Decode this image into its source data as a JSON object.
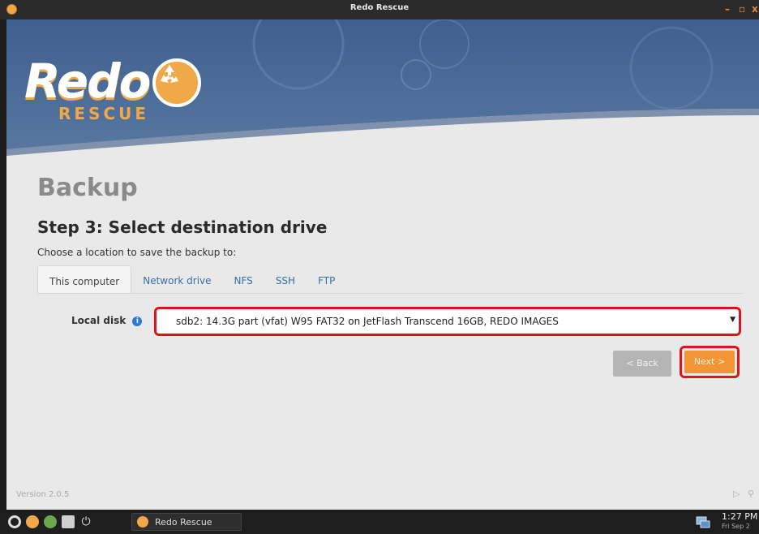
{
  "titlebar": {
    "title": "Redo Rescue",
    "minimize_icon": "minimize-icon",
    "maximize_icon": "maximize-icon",
    "close_icon": "close-icon"
  },
  "logo": {
    "word": "Redo",
    "sub": "RESCUE",
    "badge_icon": "recycle-icon"
  },
  "page": {
    "title": "Backup",
    "step_title": "Step 3: Select destination drive",
    "instruction": "Choose a location to save the backup to:"
  },
  "tabs": [
    {
      "label": "This computer",
      "active": true
    },
    {
      "label": "Network drive",
      "active": false
    },
    {
      "label": "NFS",
      "active": false
    },
    {
      "label": "SSH",
      "active": false
    },
    {
      "label": "FTP",
      "active": false
    }
  ],
  "local_disk": {
    "label": "Local disk",
    "info_icon": "info-icon",
    "selected": "sdb2: 14.3G part (vfat) W95 FAT32 on JetFlash Transcend 16GB, REDO IMAGES"
  },
  "buttons": {
    "back": "< Back",
    "next": "Next >"
  },
  "footer": {
    "version": "Version 2.0.5"
  },
  "taskbar": {
    "task_label": "Redo Rescue",
    "time": "1:27 PM",
    "date": "Fri Sep 2"
  },
  "colors": {
    "header_blue": "#4d6fa0",
    "accent_orange": "#f29535",
    "highlight_red": "#e0121a",
    "link_blue": "#3a6ea5"
  }
}
